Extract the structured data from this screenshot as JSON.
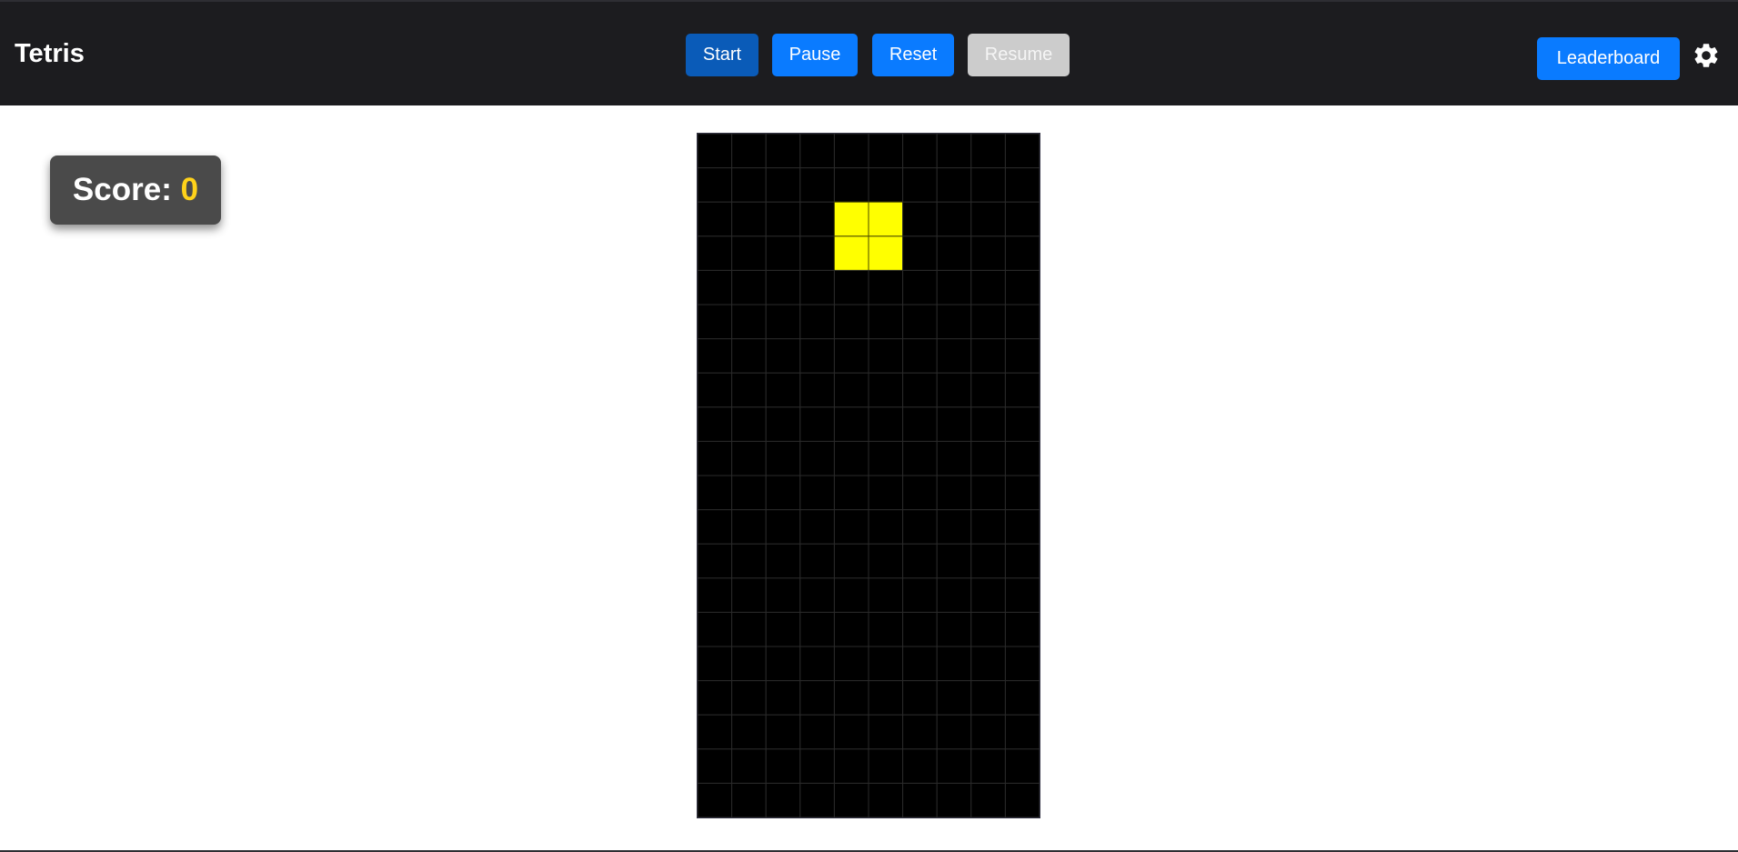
{
  "header": {
    "title": "Tetris",
    "buttons": {
      "start": "Start",
      "pause": "Pause",
      "reset": "Reset",
      "resume": "Resume",
      "leaderboard": "Leaderboard"
    },
    "settings_icon": "gear-icon"
  },
  "score": {
    "label": "Score:",
    "value": "0"
  },
  "board": {
    "columns": 10,
    "rows": 20,
    "background_color": "#000000",
    "grid_color": "#2a2a2a",
    "active_piece": {
      "type": "O",
      "color": "#ffff00",
      "cells": [
        {
          "col": 4,
          "row": 2
        },
        {
          "col": 5,
          "row": 2
        },
        {
          "col": 4,
          "row": 3
        },
        {
          "col": 5,
          "row": 3
        }
      ]
    }
  },
  "colors": {
    "header_bg": "#1c1c1f",
    "accent_blue": "#0a7bff",
    "disabled_gray": "#cccccc",
    "score_value": "#ffd21a"
  }
}
